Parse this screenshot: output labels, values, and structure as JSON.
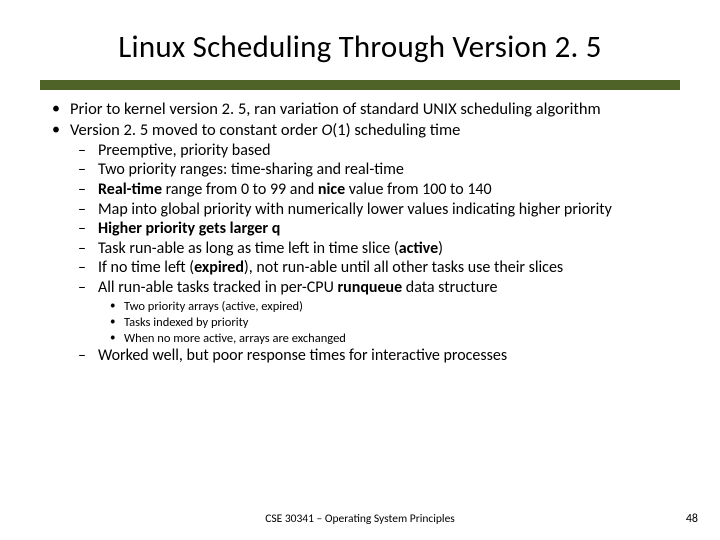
{
  "title": "Linux Scheduling Through Version 2. 5",
  "bullets": {
    "b1": "Prior to kernel version 2. 5, ran variation of standard UNIX scheduling algorithm",
    "b2_pre": "Version 2. 5 moved to constant order ",
    "b2_o": "O",
    "b2_post": "(1) scheduling time",
    "s1": "Preemptive, priority based",
    "s2": "Two priority ranges: time-sharing and real-time",
    "s3_pre": "",
    "s3_bold1": "Real-time",
    "s3_mid1": " range from 0 to 99 and ",
    "s3_bold2": "nice",
    "s3_post": " value from 100 to 140",
    "s4": "Map into  global priority with numerically lower values indicating higher priority",
    "s5": "Higher priority gets larger q",
    "s6_pre": "Task run-able as long as time left in time slice (",
    "s6_bold": "active",
    "s6_post": ")",
    "s7_pre": "If no time left (",
    "s7_bold": "expired",
    "s7_post": "), not run-able until all other tasks use their slices",
    "s8_pre": "All run-able tasks tracked in per-CPU ",
    "s8_bold": "runqueue",
    "s8_post": " data structure",
    "t1": "Two priority arrays (active, expired)",
    "t2": "Tasks indexed by priority",
    "t3": "When no more active, arrays are exchanged",
    "s9": "Worked well, but poor response times for interactive processes"
  },
  "footer": {
    "center": "CSE 30341 – Operating System Principles",
    "page": "48"
  }
}
